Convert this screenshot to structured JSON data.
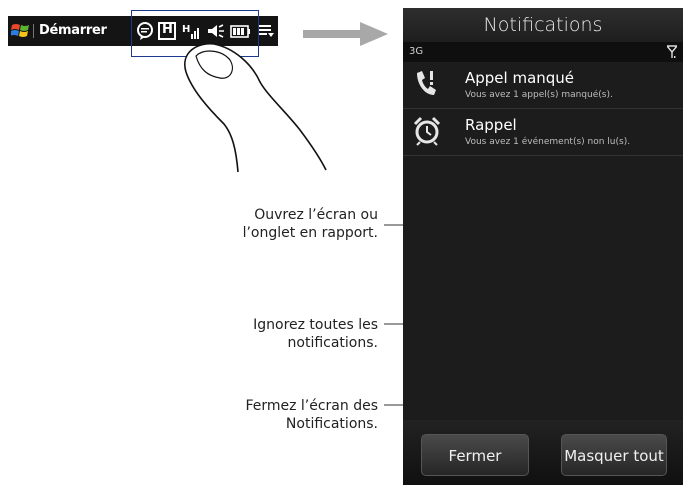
{
  "taskbar": {
    "start_label": "Démarrer",
    "icons": [
      "windows-logo-icon",
      "chat-bubble-icon",
      "hsdpa-icon",
      "signal-icon",
      "volume-icon",
      "battery-icon",
      "menu-icon"
    ],
    "hsdpa_label": "H"
  },
  "phone": {
    "title": "Notifications",
    "network": "3G",
    "notifications": [
      {
        "title": "Appel manqué",
        "subtitle": "Vous avez 1 appel(s) manqué(s).",
        "icon": "missed-call-icon"
      },
      {
        "title": "Rappel",
        "subtitle": "Vous avez 1 événement(s) non lu(s).",
        "icon": "alarm-clock-icon"
      }
    ],
    "buttons": {
      "close": "Fermer",
      "dismiss_all": "Masquer tout"
    }
  },
  "callouts": {
    "open": [
      "Ouvrez l’écran ou",
      "l’onglet en rapport."
    ],
    "ignore": [
      "Ignorez toutes les",
      "notifications."
    ],
    "close": [
      "Fermez l’écran des",
      "Notifications."
    ]
  },
  "colors": {
    "taskbar": "#141414",
    "phone_bg": "#1c1c1c",
    "leader": "#333333",
    "highlight": "#1d3a8a",
    "arrow": "#a8a8a8"
  }
}
